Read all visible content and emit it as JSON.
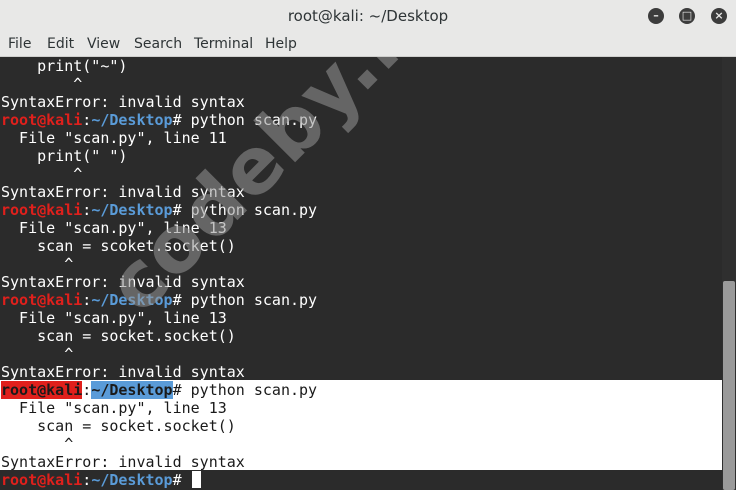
{
  "window": {
    "title": "root@kali: ~/Desktop",
    "minimize_symbol": "–",
    "maximize_symbol": "□",
    "close_symbol": "×"
  },
  "menu": {
    "file": "File",
    "edit": "Edit",
    "view": "View",
    "search": "Search",
    "terminal": "Terminal",
    "help": "Help"
  },
  "prompt": {
    "user": "root@kali",
    "colon": ":",
    "path": "~/Desktop",
    "symbol": "# "
  },
  "terminal_lines": [
    "    print(\"~\")",
    "        ^",
    "SyntaxError: invalid syntax",
    "python scan.py",
    "  File \"scan.py\", line 11",
    "    print(\" \")",
    "        ^",
    "SyntaxError: invalid syntax",
    "python scan.py",
    "  File \"scan.py\", line 13",
    "    scan = scoket.socket()",
    "       ^",
    "SyntaxError: invalid syntax",
    "python scan.py",
    "  File \"scan.py\", line 13",
    "    scan = socket.socket()",
    "       ^",
    "SyntaxError: invalid syntax",
    "python scan.py",
    "  File \"scan.py\", line 13",
    "    scan = socket.socket()",
    "       ^",
    "SyntaxError: invalid syntax"
  ],
  "watermark": "codeby.net"
}
